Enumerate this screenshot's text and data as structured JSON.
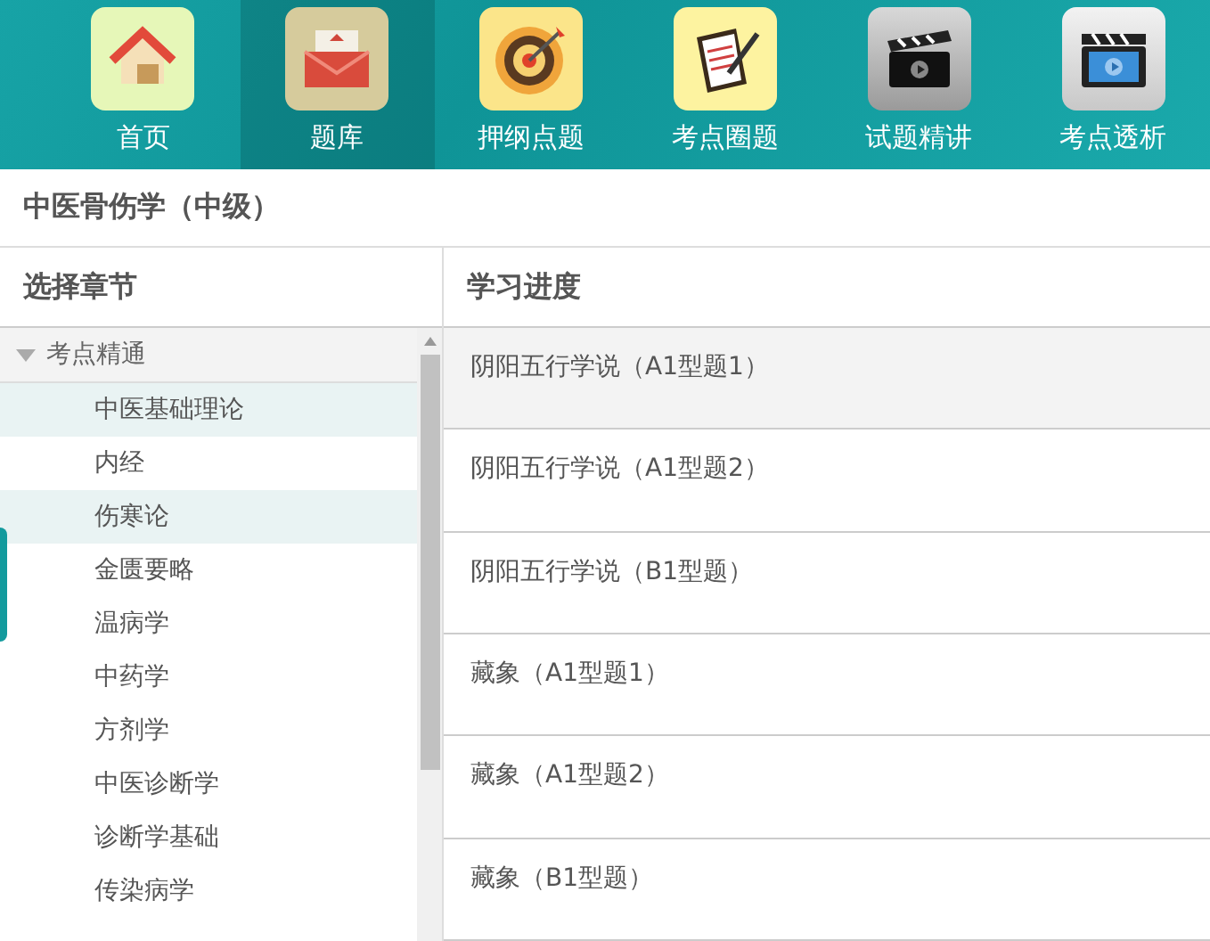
{
  "nav": [
    {
      "label": "首页",
      "kind": "home",
      "selected": false
    },
    {
      "label": "题库",
      "kind": "bank",
      "selected": true
    },
    {
      "label": "押纲点题",
      "kind": "target",
      "selected": false
    },
    {
      "label": "考点圈题",
      "kind": "clipboard",
      "selected": false
    },
    {
      "label": "试题精讲",
      "kind": "clapper",
      "selected": false
    },
    {
      "label": "考点透析",
      "kind": "video",
      "selected": false
    }
  ],
  "course_title": "中医骨伤学（中级）",
  "sidebar": {
    "heading": "选择章节",
    "tree": [
      {
        "label": "考点精通",
        "expanded": true,
        "children": [
          {
            "label": "中医基础理论",
            "selected": true
          },
          {
            "label": "内经",
            "selected": false
          },
          {
            "label": "伤寒论",
            "selected": true
          },
          {
            "label": "金匮要略",
            "selected": false
          },
          {
            "label": "温病学",
            "selected": false
          },
          {
            "label": "中药学",
            "selected": false
          },
          {
            "label": "方剂学",
            "selected": false
          },
          {
            "label": "中医诊断学",
            "selected": false
          },
          {
            "label": "诊断学基础",
            "selected": false
          },
          {
            "label": "传染病学",
            "selected": false
          }
        ]
      }
    ]
  },
  "progress": {
    "heading": "学习进度",
    "rows": [
      {
        "label": "阴阳五行学说（A1型题1）",
        "selected": true
      },
      {
        "label": "阴阳五行学说（A1型题2）",
        "selected": false
      },
      {
        "label": "阴阳五行学说（B1型题）",
        "selected": false
      },
      {
        "label": "藏象（A1型题1）",
        "selected": false
      },
      {
        "label": "藏象（A1型题2）",
        "selected": false
      },
      {
        "label": "藏象（B1型题）",
        "selected": false
      }
    ]
  }
}
